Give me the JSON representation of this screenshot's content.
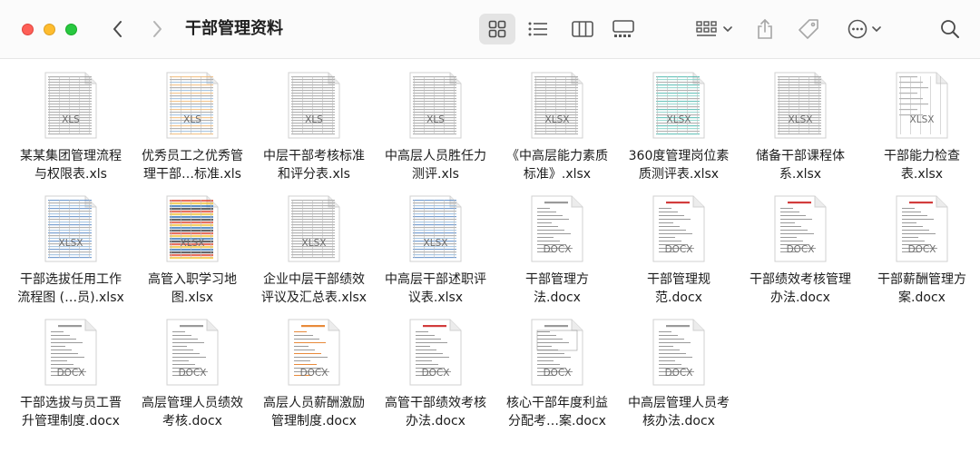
{
  "window": {
    "title": "干部管理资料"
  },
  "colors": {
    "red": "#fe5f57",
    "yellow": "#febc2e",
    "green": "#28c840",
    "toolbar_bg": "#fbfbfb",
    "active_btn": "#e4e4e4",
    "icon": "#5b5b5b"
  },
  "toolbar": {
    "icons": [
      "back-icon",
      "forward-icon",
      "icon-view-icon",
      "list-view-icon",
      "column-view-icon",
      "gallery-view-icon",
      "group-icon",
      "share-icon",
      "tag-icon",
      "more-icon",
      "search-icon"
    ],
    "active_view": "icon-view"
  },
  "files": [
    {
      "name": "某某集团管理流程\n与权限表.xls",
      "ext": "XLS",
      "kind": "sheet"
    },
    {
      "name": "优秀员工之优秀管\n理干部…标准.xls",
      "ext": "XLS",
      "kind": "sheet-color"
    },
    {
      "name": "中层干部考核标准\n和评分表.xls",
      "ext": "XLS",
      "kind": "sheet"
    },
    {
      "name": "中高层人员胜任力\n测评.xls",
      "ext": "XLS",
      "kind": "sheet"
    },
    {
      "name": "《中高层能力素质\n标准》.xlsx",
      "ext": "XLSX",
      "kind": "sheet"
    },
    {
      "name": "360度管理岗位素\n质测评表.xlsx",
      "ext": "XLSX",
      "kind": "sheet-teal"
    },
    {
      "name": "储备干部课程体\n系.xlsx",
      "ext": "XLSX",
      "kind": "sheet"
    },
    {
      "name": "干部能力检查\n表.xlsx",
      "ext": "XLSX",
      "kind": "sheet-sparse"
    },
    {
      "name": "干部选拔任用工作\n流程图 (…员).xlsx",
      "ext": "XLSX",
      "kind": "sheet-blue"
    },
    {
      "name": "高管入职学习地\n图.xlsx",
      "ext": "XLSX",
      "kind": "sheet-vivid"
    },
    {
      "name": "企业中层干部绩效\n评议及汇总表.xlsx",
      "ext": "XLSX",
      "kind": "sheet"
    },
    {
      "name": "中高层干部述职评\n议表.xlsx",
      "ext": "XLSX",
      "kind": "sheet-blue"
    },
    {
      "name": "干部管理方\n法.docx",
      "ext": "DOCX",
      "kind": "doc"
    },
    {
      "name": "干部管理规\n范.docx",
      "ext": "DOCX",
      "kind": "doc-red"
    },
    {
      "name": "干部绩效考核管理\n办法.docx",
      "ext": "DOCX",
      "kind": "doc-red"
    },
    {
      "name": "干部薪酬管理方\n案.docx",
      "ext": "DOCX",
      "kind": "doc-red"
    },
    {
      "name": "干部选拔与员工晋\n升管理制度.docx",
      "ext": "DOCX",
      "kind": "doc"
    },
    {
      "name": "高层管理人员绩效\n考核.docx",
      "ext": "DOCX",
      "kind": "doc"
    },
    {
      "name": "高层人员薪酬激励\n管理制度.docx",
      "ext": "DOCX",
      "kind": "doc-orange"
    },
    {
      "name": "高管干部绩效考核\n办法.docx",
      "ext": "DOCX",
      "kind": "doc-red"
    },
    {
      "name": "核心干部年度利益\n分配考…案.docx",
      "ext": "DOCX",
      "kind": "doc-form"
    },
    {
      "name": "中高层管理人员考\n核办法.docx",
      "ext": "DOCX",
      "kind": "doc"
    }
  ]
}
